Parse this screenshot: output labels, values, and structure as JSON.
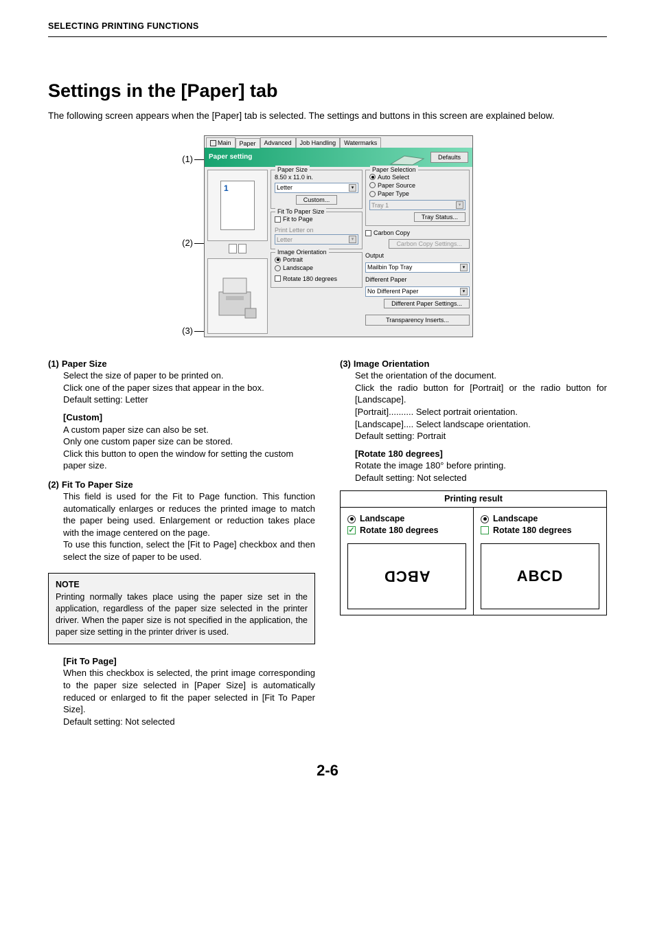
{
  "header": "SELECTING PRINTING FUNCTIONS",
  "title": "Settings in the [Paper] tab",
  "intro": "The following screen appears when the [Paper] tab is selected. The settings and buttons in this screen are explained below.",
  "callouts": {
    "c1": "(1)",
    "c2": "(2)",
    "c3": "(3)"
  },
  "dlg": {
    "tabs": {
      "main": "Main",
      "paper": "Paper",
      "advanced": "Advanced",
      "job": "Job Handling",
      "water": "Watermarks"
    },
    "barTitle": "Paper setting",
    "defaults": "Defaults",
    "pv_num": "1",
    "paperSize": {
      "title": "Paper Size",
      "dim": "8.50 x 11.0 in.",
      "sel": "Letter",
      "custom": "Custom..."
    },
    "fitTo": {
      "title": "Fit To Paper Size",
      "chk": "Fit to Page",
      "msg": "Print Letter on",
      "sel": "Letter"
    },
    "orient": {
      "title": "Image Orientation",
      "portrait": "Portrait",
      "landscape": "Landscape",
      "rotate": "Rotate 180 degrees"
    },
    "paperSel": {
      "title": "Paper Selection",
      "auto": "Auto Select",
      "source": "Paper Source",
      "type": "Paper Type",
      "tray": "Tray 1",
      "trayStatus": "Tray Status..."
    },
    "carbon": {
      "chk": "Carbon Copy",
      "btn": "Carbon Copy Settings..."
    },
    "output": {
      "lbl": "Output",
      "sel": "Mailbin Top Tray"
    },
    "diff": {
      "lbl": "Different Paper",
      "sel": "No Different Paper",
      "btn": "Different Paper Settings..."
    },
    "trans": "Transparency Inserts..."
  },
  "s1": {
    "num": "(1)",
    "title": "Paper Size",
    "p1": "Select the size of paper to be printed on.",
    "p2": "Click one of the paper sizes that appear in the box.",
    "p3": "Default setting: Letter",
    "custom": "[Custom]",
    "c1": "A custom paper size can also be set.",
    "c2": "Only one custom paper size can be stored.",
    "c3": "Click this button to open the window for setting the custom paper size."
  },
  "s2": {
    "num": "(2)",
    "title": "Fit To Paper Size",
    "p1": "This field is used for the Fit to Page function. This function automatically enlarges or reduces the printed image to match the paper being used. Enlargement or reduction takes place with the image centered on the page.",
    "p2": "To use this function, select the [Fit to Page] checkbox and then select the size of paper to be used."
  },
  "note": {
    "title": "NOTE",
    "body": "Printing normally takes place using the paper size set in the application, regardless of the paper size selected in the printer driver. When the paper size is not specified in the application, the paper size setting in the printer driver is used."
  },
  "s2b": {
    "title": "[Fit To Page]",
    "p1": "When this checkbox is selected, the print image corresponding to the paper size selected in [Paper Size] is automatically reduced or enlarged to fit the paper selected in [Fit To Paper Size].",
    "p2": "Default setting: Not selected"
  },
  "s3": {
    "num": "(3)",
    "title": "Image Orientation",
    "p1": "Set the orientation of the document.",
    "p2": "Click the radio button for [Portrait] or the radio button for [Landscape].",
    "p3": "[Portrait].......... Select portrait orientation.",
    "p4": "[Landscape].... Select landscape orientation.",
    "p5": "Default setting: Portrait",
    "rot": "[Rotate 180 degrees]",
    "r1": "Rotate the image 180° before printing.",
    "r2": "Default setting: Not selected"
  },
  "pr": {
    "title": "Printing result",
    "landscape": "Landscape",
    "rotate": "Rotate 180 degrees",
    "abcd": "ABCD"
  },
  "pagenum": "2-6"
}
